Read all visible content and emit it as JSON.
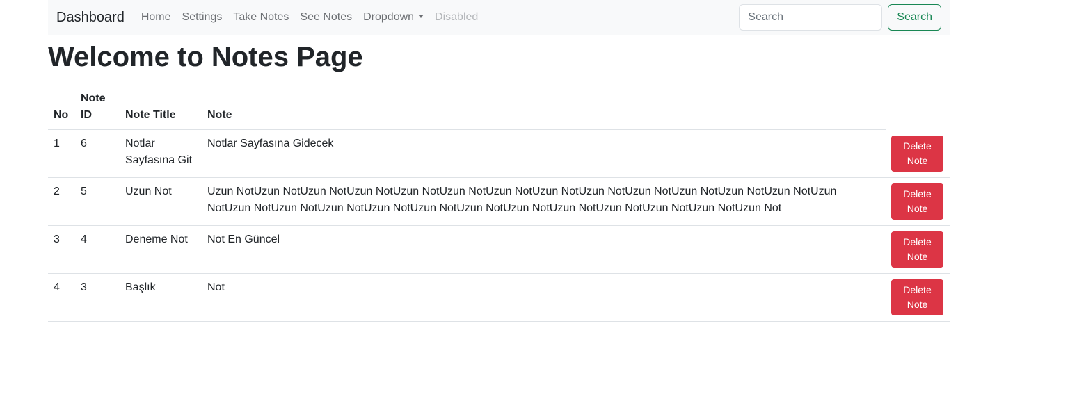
{
  "navbar": {
    "brand": "Dashboard",
    "links": {
      "home": "Home",
      "settings": "Settings",
      "take_notes": "Take Notes",
      "see_notes": "See Notes",
      "dropdown": "Dropdown",
      "disabled": "Disabled"
    },
    "search": {
      "placeholder": "Search",
      "value": "",
      "button_label": "Search"
    }
  },
  "page": {
    "title": "Welcome to Notes Page"
  },
  "table": {
    "headers": {
      "no": "No",
      "note_id": "Note ID",
      "note_title": "Note Title",
      "note": "Note"
    },
    "rows": [
      {
        "no": "1",
        "note_id": "6",
        "note_title": "Notlar Sayfasına Git",
        "note": "Notlar Sayfasına Gidecek",
        "action_label": "Delete Note"
      },
      {
        "no": "2",
        "note_id": "5",
        "note_title": "Uzun Not",
        "note": "Uzun NotUzun NotUzun NotUzun NotUzun NotUzun NotUzun NotUzun NotUzun NotUzun NotUzun NotUzun NotUzun NotUzun NotUzun NotUzun NotUzun NotUzun NotUzun NotUzun NotUzun NotUzun NotUzun NotUzun NotUzun NotUzun Not",
        "action_label": "Delete Note"
      },
      {
        "no": "3",
        "note_id": "4",
        "note_title": "Deneme Not",
        "note": "Not En Güncel",
        "action_label": "Delete Note"
      },
      {
        "no": "4",
        "note_id": "3",
        "note_title": "Başlık",
        "note": "Not",
        "action_label": "Delete Note"
      }
    ]
  },
  "colors": {
    "navbar_bg": "#f8f9fa",
    "search_button": "#198754",
    "delete_button": "#dc3545",
    "text": "#212529"
  }
}
